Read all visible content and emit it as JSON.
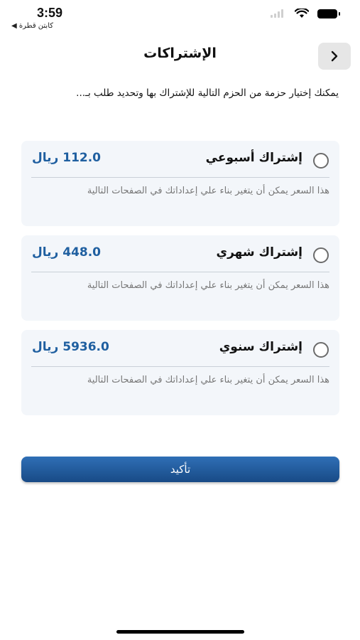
{
  "status_bar": {
    "time": "3:59",
    "back_app": "◀ كابتن قطرة"
  },
  "header": {
    "title": "الإشتراكات",
    "back_icon": "chevron-right-icon"
  },
  "intro_text": "يمكنك إختيار حزمة من الحزم التالية للإشتراك بها وتحديد طلب بـ...",
  "plans": [
    {
      "name": "إشتراك أسبوعي",
      "price": "112.0 ريال",
      "note": "هذا السعر يمكن أن يتغير بناء علي إعداداتك في الصفحات التالية",
      "selected": false
    },
    {
      "name": "إشتراك شهري",
      "price": "448.0 ريال",
      "note": "هذا السعر يمكن أن يتغير بناء علي إعداداتك في الصفحات التالية",
      "selected": false
    },
    {
      "name": "إشتراك سنوي",
      "price": "5936.0 ريال",
      "note": "هذا السعر يمكن أن يتغير بناء علي إعداداتك في الصفحات التالية",
      "selected": false
    }
  ],
  "confirm_label": "تأكيد",
  "colors": {
    "accent": "#1f5fa0",
    "button": "#2462a8",
    "card_bg": "#f3f6fa"
  }
}
